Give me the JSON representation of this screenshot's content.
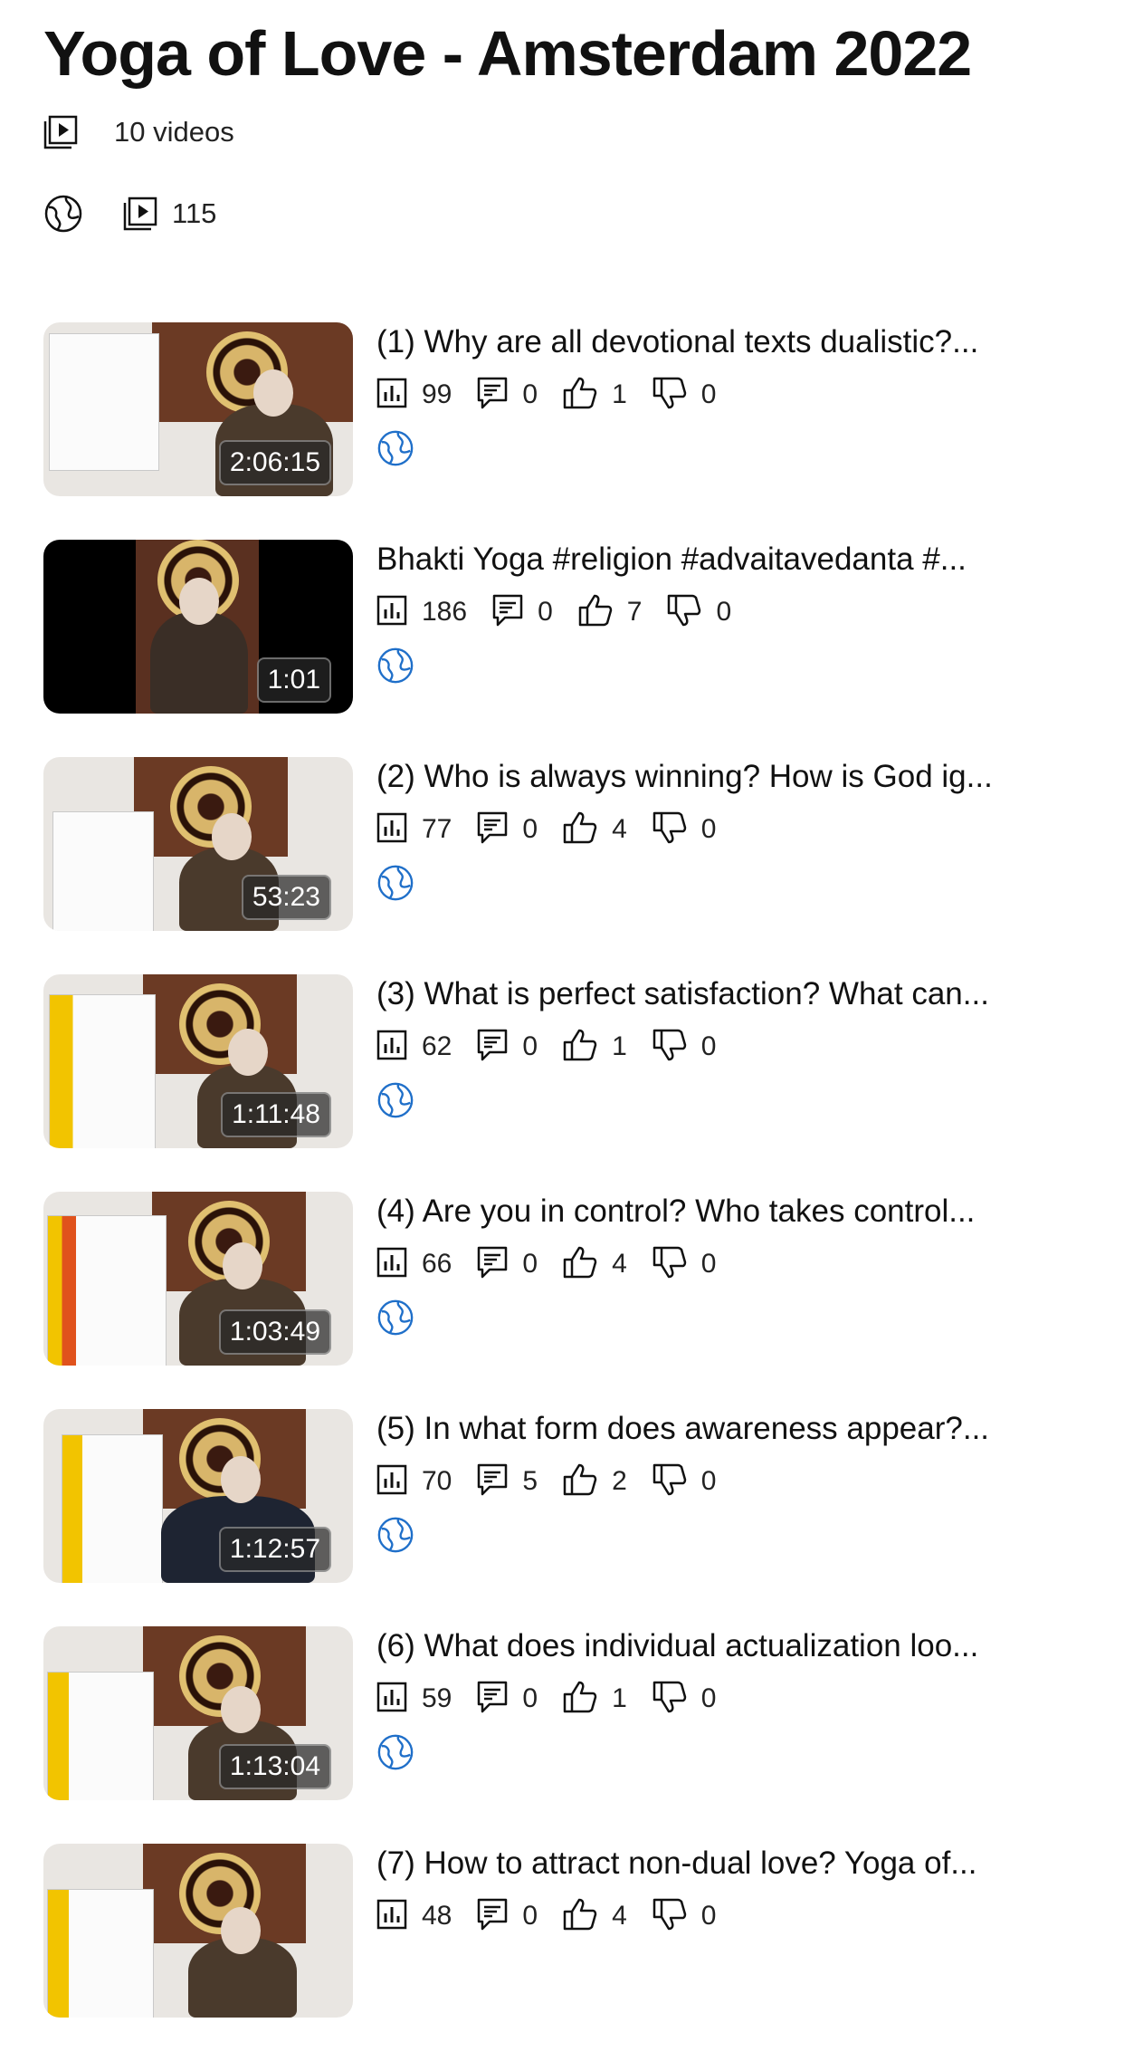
{
  "playlist": {
    "title": "Yoga of Love - Amsterdam 2022",
    "video_count": "10 videos",
    "visibility_icon": "globe-icon",
    "total_videos": "115"
  },
  "videos": [
    {
      "title": "(1) Why are all devotional texts dualistic?...",
      "duration": "2:06:15",
      "views": "99",
      "comments": "0",
      "likes": "1",
      "dislikes": "0"
    },
    {
      "title": "Bhakti Yoga #religion  #advaitavedanta  #...",
      "duration": "1:01",
      "views": "186",
      "comments": "0",
      "likes": "7",
      "dislikes": "0"
    },
    {
      "title": "(2) Who is always winning? How is God ig...",
      "duration": "53:23",
      "views": "77",
      "comments": "0",
      "likes": "4",
      "dislikes": "0"
    },
    {
      "title": "(3) What is perfect satisfaction? What can...",
      "duration": "1:11:48",
      "views": "62",
      "comments": "0",
      "likes": "1",
      "dislikes": "0"
    },
    {
      "title": "(4) Are you in control? Who takes control...",
      "duration": "1:03:49",
      "views": "66",
      "comments": "0",
      "likes": "4",
      "dislikes": "0"
    },
    {
      "title": "(5) In what form does awareness appear?...",
      "duration": "1:12:57",
      "views": "70",
      "comments": "5",
      "likes": "2",
      "dislikes": "0"
    },
    {
      "title": "(6) What does individual actualization loo...",
      "duration": "1:13:04",
      "views": "59",
      "comments": "0",
      "likes": "1",
      "dislikes": "0"
    },
    {
      "title": "(7) How to attract non-dual love? Yoga of...",
      "duration": "",
      "views": "48",
      "comments": "0",
      "likes": "4",
      "dislikes": "0"
    }
  ],
  "colors": {
    "text": "#111111",
    "accent_globe": "#1f6fc9"
  }
}
